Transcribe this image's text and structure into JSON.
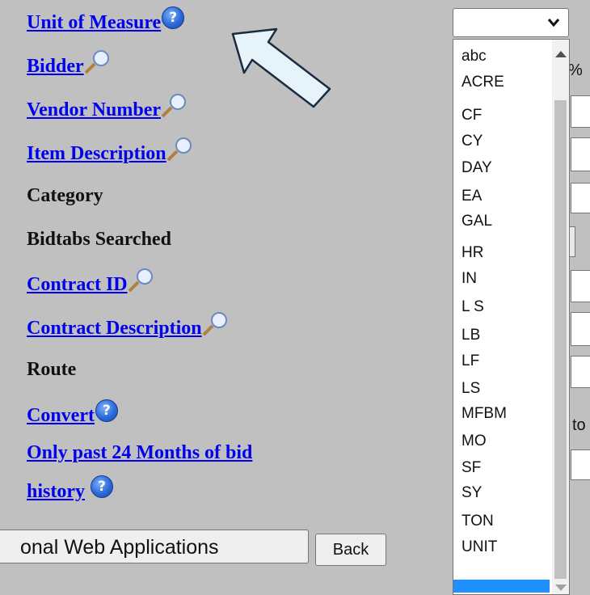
{
  "form": {
    "unit_of_measure": "Unit of Measure",
    "bidder": "Bidder",
    "vendor_number": "Vendor Number",
    "item_description": "Item Description",
    "category": "Category",
    "bidtabs_searched": "Bidtabs Searched",
    "contract_id": "Contract ID",
    "contract_description": "Contract Description",
    "route": "Route",
    "convert": "Convert",
    "only_past_line1": "Only past 24 Months of bid",
    "only_past_line2": "history"
  },
  "icons": {
    "help": "help-icon",
    "lookup": "magnifier-icon"
  },
  "right_fragments": {
    "percent": "%",
    "to": "to"
  },
  "buttons": {
    "web_apps": "onal Web Applications",
    "back": "Back"
  },
  "dropdown": {
    "selected_value": "",
    "options": [
      "abc",
      "ACRE",
      "CF",
      "CY",
      "DAY",
      "EA",
      "GAL",
      "HR",
      "IN",
      "L S",
      "LB",
      "LF",
      "LS",
      "MFBM",
      "MO",
      "SF",
      "SY",
      "TON",
      "UNIT",
      ""
    ],
    "highlighted_index": 19
  },
  "annotation": {
    "type": "callout-arrow",
    "color": "#e6f3f8",
    "stroke": "#1a2a40"
  }
}
